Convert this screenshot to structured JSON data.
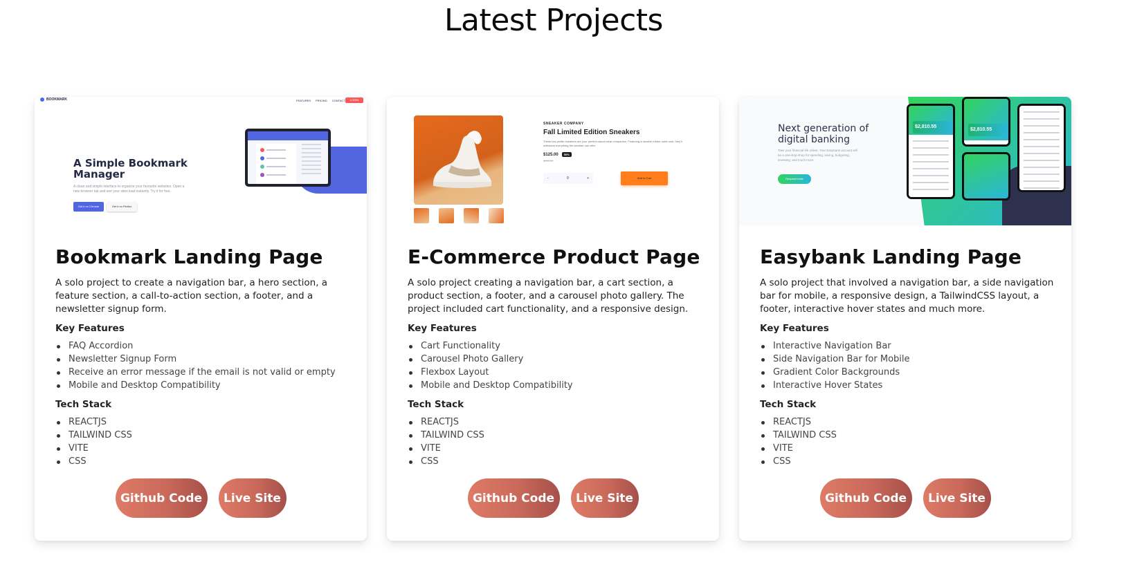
{
  "page": {
    "title": "Latest Projects"
  },
  "projects": [
    {
      "title": "Bookmark Landing Page",
      "description": "A solo project to create a navigation bar, a hero section, a feature section, a call-to-action section, a footer, and a newsletter signup form.",
      "features_heading": "Key Features",
      "features": [
        "FAQ Accordion",
        "Newsletter Signup Form",
        "Receive an error message if the email is not valid or empty",
        "Mobile and Desktop Compatibility"
      ],
      "stack_heading": "Tech Stack",
      "stack": [
        "REACTJS",
        "TAILWIND CSS",
        "VITE",
        "CSS"
      ],
      "github_label": "Github Code",
      "live_label": "Live Site",
      "preview": {
        "logo": "BOOKMARK",
        "nav": [
          "FEATURES",
          "PRICING",
          "CONTACT"
        ],
        "login": "LOGIN",
        "hero": "A Simple Bookmark Manager",
        "sub": "A clean and simple interface to organize your favourite websites. Open a new browser tab and see your sites load instantly. Try it for free.",
        "btn_a": "Get it on Chrome",
        "btn_b": "Get it on Firefox"
      }
    },
    {
      "title": "E-Commerce Product Page",
      "description": "A solo project creating a navigation bar, a cart section, a product section, a footer, and a carousel photo gallery. The project included cart functionality, and a responsive design.",
      "features_heading": "Key Features",
      "features": [
        "Cart Functionality",
        "Carousel Photo Gallery",
        "Flexbox Layout",
        "Mobile and Desktop Compatibility"
      ],
      "stack_heading": "Tech Stack",
      "stack": [
        "REACTJS",
        "TAILWIND CSS",
        "VITE",
        "CSS"
      ],
      "github_label": "Github Code",
      "live_label": "Live Site",
      "preview": {
        "company": "SNEAKER COMPANY",
        "product": "Fall Limited Edition Sneakers",
        "desc": "These low-profile sneakers are your perfect casual wear companion. Featuring a durable rubber outer sole, they'll withstand everything the weather can offer.",
        "price": "$125.00",
        "discount": "50%",
        "old_price": "$250.00",
        "qty_minus": "-",
        "qty": "0",
        "qty_plus": "+",
        "cart": "Add to Cart"
      }
    },
    {
      "title": "Easybank Landing Page",
      "description": "A solo project that involved a navigation bar, a side navigation bar for mobile, a responsive design, a TailwindCSS layout, a footer, interactive hover states and much more.",
      "features_heading": "Key Features",
      "features": [
        "Interactive Navigation Bar",
        "Side Navigation Bar for Mobile",
        "Gradient Color Backgrounds",
        "Interactive Hover States"
      ],
      "stack_heading": "Tech Stack",
      "stack": [
        "REACTJS",
        "TAILWIND CSS",
        "VITE",
        "CSS"
      ],
      "github_label": "Github Code",
      "live_label": "Live Site",
      "preview": {
        "hero": "Next generation of digital banking",
        "sub": "Take your financial life online. Your Easybank account will be a one-stop-shop for spending, saving, budgeting, investing, and much more.",
        "btn": "Request Invite",
        "balance": "$2,810.55"
      }
    }
  ]
}
